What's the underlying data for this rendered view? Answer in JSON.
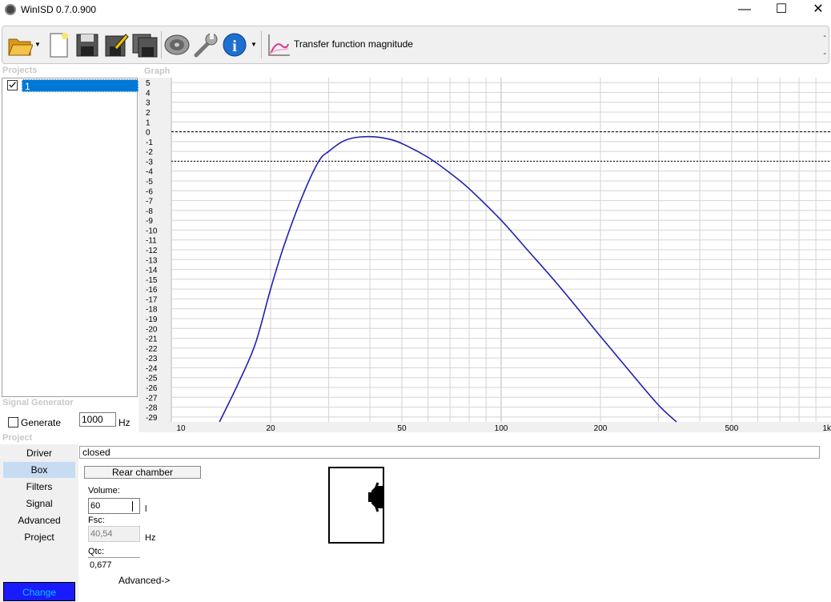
{
  "window": {
    "title": "WinISD 0.7.0.900",
    "minimize": "—",
    "maximize": "☐",
    "close": "✕"
  },
  "toolbar": {
    "graph_selector_label": "Transfer function magnitude",
    "overflow_top": "-",
    "overflow_bottom": "-"
  },
  "sections": {
    "projects": "Projects",
    "graph": "Graph",
    "signal_generator": "Signal Generator",
    "project": "Project"
  },
  "projects": [
    {
      "name": "1",
      "checked": true
    }
  ],
  "signal_generator": {
    "generate_label": "Generate",
    "frequency": "1000",
    "unit": "Hz",
    "checked": false
  },
  "nav": {
    "items": [
      "Driver",
      "Box",
      "Filters",
      "Signal",
      "Advanced",
      "Project"
    ],
    "active": "Box",
    "change_label": "Change"
  },
  "box": {
    "type": "closed",
    "rear_chamber_label": "Rear chamber",
    "volume_label": "Volume:",
    "volume_value": "60",
    "volume_unit": "l",
    "fsc_label": "Fsc:",
    "fsc_value": "40,54",
    "fsc_unit": "Hz",
    "qtc_label": "Qtc:",
    "qtc_value": "0,677",
    "advanced_label": "Advanced->"
  },
  "colors": {
    "curve": "#2020b0",
    "selection": "#0078d7",
    "change_button": "#1a1aff",
    "active_nav": "#c7dcf2"
  },
  "chart_data": {
    "type": "line",
    "title": "",
    "xlabel": "",
    "ylabel": "",
    "x_scale": "log",
    "xlim": [
      10,
      1000
    ],
    "ylim": [
      -29.5,
      5.5
    ],
    "x_tick_labels": [
      {
        "v": 10,
        "t": "10"
      },
      {
        "v": 20,
        "t": "20"
      },
      {
        "v": 50,
        "t": "50"
      },
      {
        "v": 100,
        "t": "100"
      },
      {
        "v": 200,
        "t": "200"
      },
      {
        "v": 500,
        "t": "500"
      },
      {
        "v": 1000,
        "t": "1k"
      }
    ],
    "y_ticks": [
      5,
      4,
      3,
      2,
      1,
      0,
      -1,
      -2,
      -3,
      -4,
      -5,
      -6,
      -7,
      -8,
      -9,
      -10,
      -11,
      -12,
      -13,
      -14,
      -15,
      -16,
      -17,
      -18,
      -19,
      -20,
      -21,
      -22,
      -23,
      -24,
      -25,
      -26,
      -27,
      -28,
      -29
    ],
    "reference_lines": [
      0,
      -3
    ],
    "grid": true,
    "series": [
      {
        "x": [
          14,
          16,
          18,
          20,
          22,
          25,
          28,
          30,
          33,
          36,
          40,
          45,
          50,
          60,
          70,
          80,
          100,
          120,
          150,
          200,
          250,
          300,
          340
        ],
        "y": [
          -29.5,
          -25.5,
          -21.5,
          -16.0,
          -11.5,
          -6.5,
          -3.0,
          -2.0,
          -1.0,
          -0.6,
          -0.5,
          -0.7,
          -1.2,
          -2.6,
          -4.2,
          -5.8,
          -9.0,
          -12.0,
          -15.7,
          -20.8,
          -24.7,
          -27.8,
          -29.5
        ]
      }
    ]
  }
}
